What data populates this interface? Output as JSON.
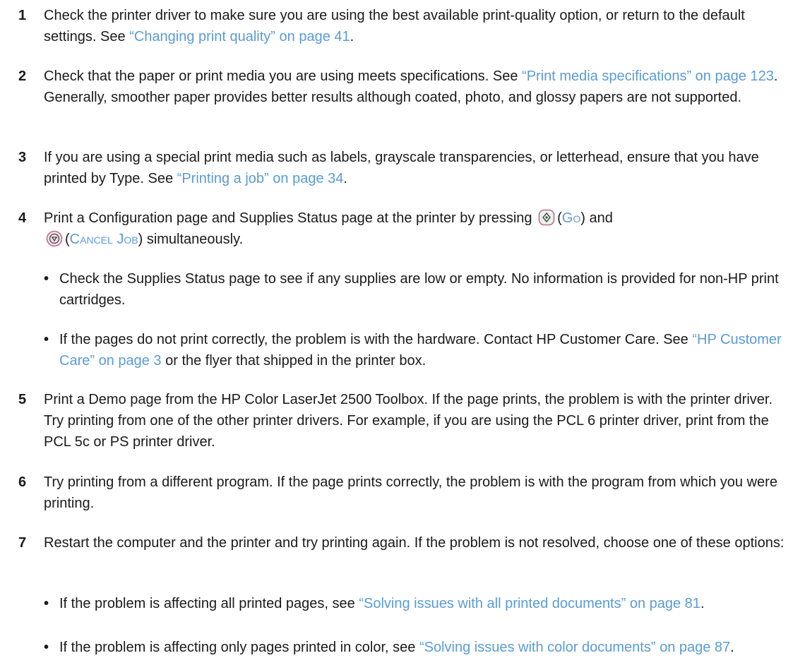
{
  "steps": [
    {
      "num": "1",
      "t1": "Check the printer driver to make sure you are using the best available print-quality option, or return to the default settings. See ",
      "link": "“Changing print quality” on page 41",
      "t2": "."
    },
    {
      "num": "2",
      "t1": "Check that the paper or print media you are using meets specifications. See ",
      "link": "“Print media specifications” on page 123",
      "t2": ". Generally, smoother paper provides better results although coated, photo, and glossy papers are not supported."
    },
    {
      "num": "3",
      "t1": "If you are using a special print media such as labels, grayscale transparencies, or letterhead, ensure that you have printed by Type. See ",
      "link": "“Printing a job” on page 34",
      "t2": "."
    },
    {
      "num": "4",
      "t1": "Print a Configuration page and Supplies Status page at the printer by pressing ",
      "go_label": "Go",
      "t2": " and ",
      "cancel_label": "Cancel Job",
      "t3": " simultaneously.",
      "bullets": [
        {
          "text": "Check the Supplies Status page to see if any supplies are low or empty. No information is provided for non-HP print cartridges."
        },
        {
          "t1": "If the pages do not print correctly, the problem is with the hardware. Contact HP Customer Care. See ",
          "link": "“HP Customer Care” on page 3",
          "t2": " or the flyer that shipped in the printer box."
        }
      ]
    },
    {
      "num": "5",
      "text": "Print a Demo page from the HP Color LaserJet 2500 Toolbox. If the page prints, the problem is with the printer driver. Try printing from one of the other printer drivers. For example, if you are using the PCL 6 printer driver, print from the PCL 5c or PS printer driver."
    },
    {
      "num": "6",
      "text": "Try printing from a different program. If the page prints correctly, the problem is with the program from which you were printing."
    },
    {
      "num": "7",
      "text": "Restart the computer and the printer and try printing again. If the problem is not resolved, choose one of these options:",
      "bullets": [
        {
          "t1": "If the problem is affecting all printed pages, see ",
          "link": "“Solving issues with all printed documents” on page 81",
          "t2": "."
        },
        {
          "t1": "If the problem is affecting only pages printed in color, see ",
          "link": "“Solving issues with color documents” on page 87",
          "t2": "."
        }
      ]
    }
  ],
  "colors": {
    "link": "#5b9bd5",
    "text": "#1a1a1a",
    "button_outline": "#c46a8c",
    "button_fill": "#e8f3ec"
  },
  "icons": {
    "go": "go-button-icon",
    "cancel": "cancel-job-button-icon"
  }
}
